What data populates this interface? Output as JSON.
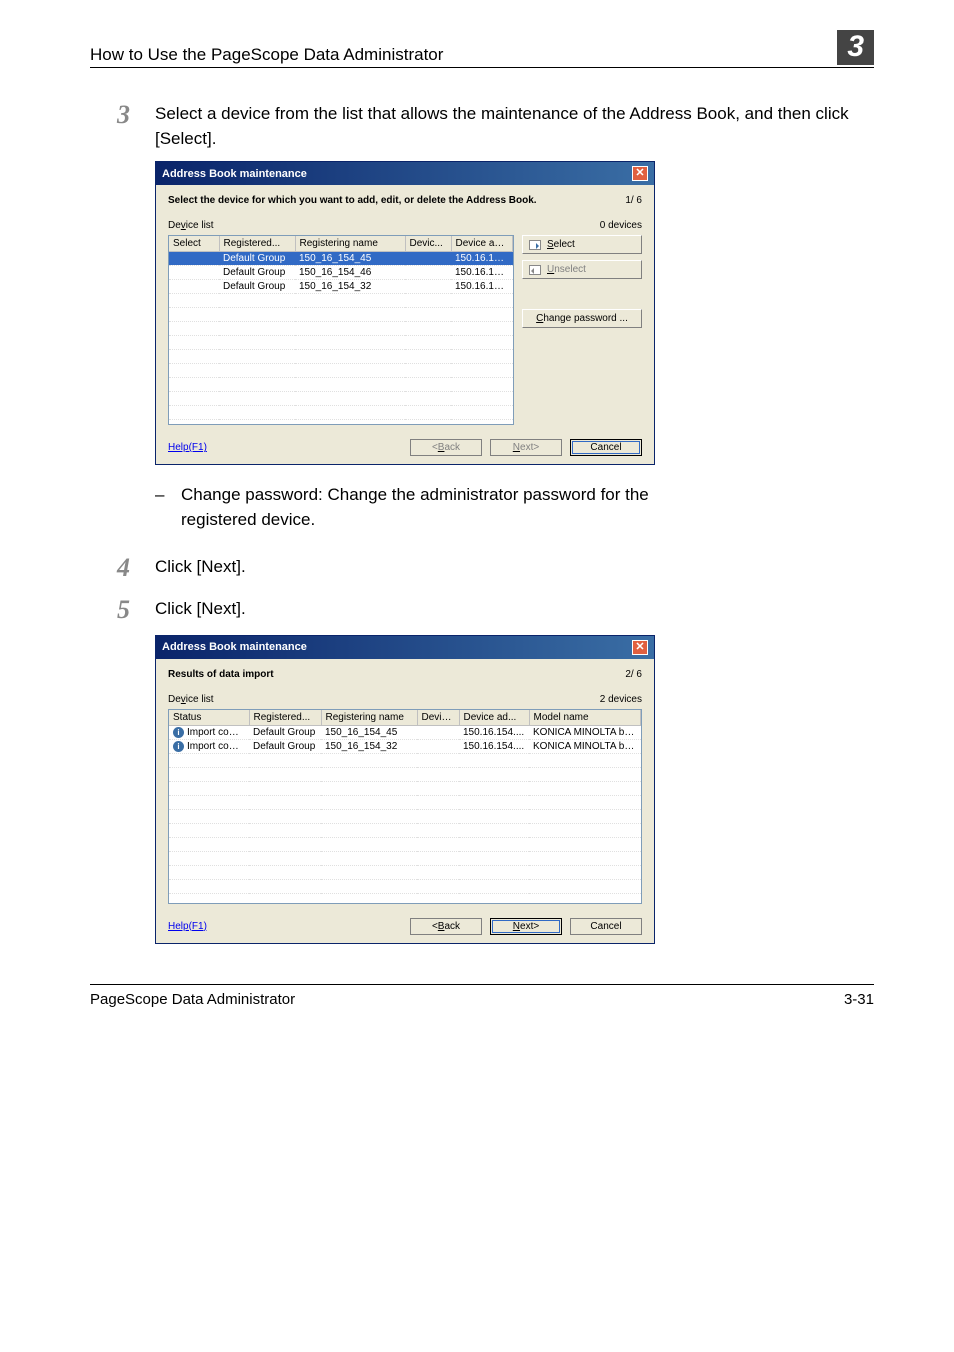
{
  "header": {
    "left": "How to Use the PageScope Data Administrator",
    "chapter_num": "3"
  },
  "footer": {
    "left": "PageScope Data Administrator",
    "right": "3-31"
  },
  "steps": {
    "s3": {
      "num": "3",
      "text": "Select a device from the list that allows the maintenance of the Address Book, and then click [Select]."
    },
    "bullet": {
      "dash": "–",
      "text": "Change password: Change the administrator password for the registered device."
    },
    "s4": {
      "num": "4",
      "text": "Click [Next]."
    },
    "s5": {
      "num": "5",
      "text": "Click [Next]."
    }
  },
  "dialog1": {
    "title": "Address Book maintenance",
    "instruction": "Select the device for which you want to add, edit, or delete the Address Book.",
    "step_indicator": "1/ 6",
    "device_list_label": "Device list",
    "device_count": "0 devices",
    "cols": {
      "select": "Select",
      "registered": "Registered...",
      "registering_name": "Registering name",
      "devic": "Devic...",
      "device_ad": "Device ad..."
    },
    "rows": [
      {
        "registered": "Default Group",
        "name": "150_16_154_45",
        "devic": "",
        "addr": "150.16.154...",
        "selected": true
      },
      {
        "registered": "Default Group",
        "name": "150_16_154_46",
        "devic": "",
        "addr": "150.16.154...",
        "selected": false
      },
      {
        "registered": "Default Group",
        "name": "150_16_154_32",
        "devic": "",
        "addr": "150.16.154...",
        "selected": false
      }
    ],
    "btn_select": "Select",
    "btn_unselect": "Unselect",
    "btn_change_pwd": "Change password...",
    "help": "Help(F1)",
    "back": "<Back",
    "next": "Next>",
    "cancel": "Cancel"
  },
  "dialog2": {
    "title": "Address Book maintenance",
    "heading": "Results of data import",
    "step_indicator": "2/ 6",
    "device_list_label": "Device list",
    "device_count": "2 devices",
    "cols": {
      "status": "Status",
      "registered": "Registered...",
      "registering_name": "Registering name",
      "devic": "Devic...",
      "device_ad": "Device ad...",
      "model_name": "Model name"
    },
    "rows": [
      {
        "status": "Import compl...",
        "registered": "Default Group",
        "name": "150_16_154_45",
        "devic": "",
        "addr": "150.16.154....",
        "model": "KONICA MINOLTA bizh..."
      },
      {
        "status": "Import compl...",
        "registered": "Default Group",
        "name": "150_16_154_32",
        "devic": "",
        "addr": "150.16.154....",
        "model": "KONICA MINOLTA bizh..."
      }
    ],
    "help": "Help(F1)",
    "back": "<Back",
    "next": "Next>",
    "cancel": "Cancel"
  }
}
